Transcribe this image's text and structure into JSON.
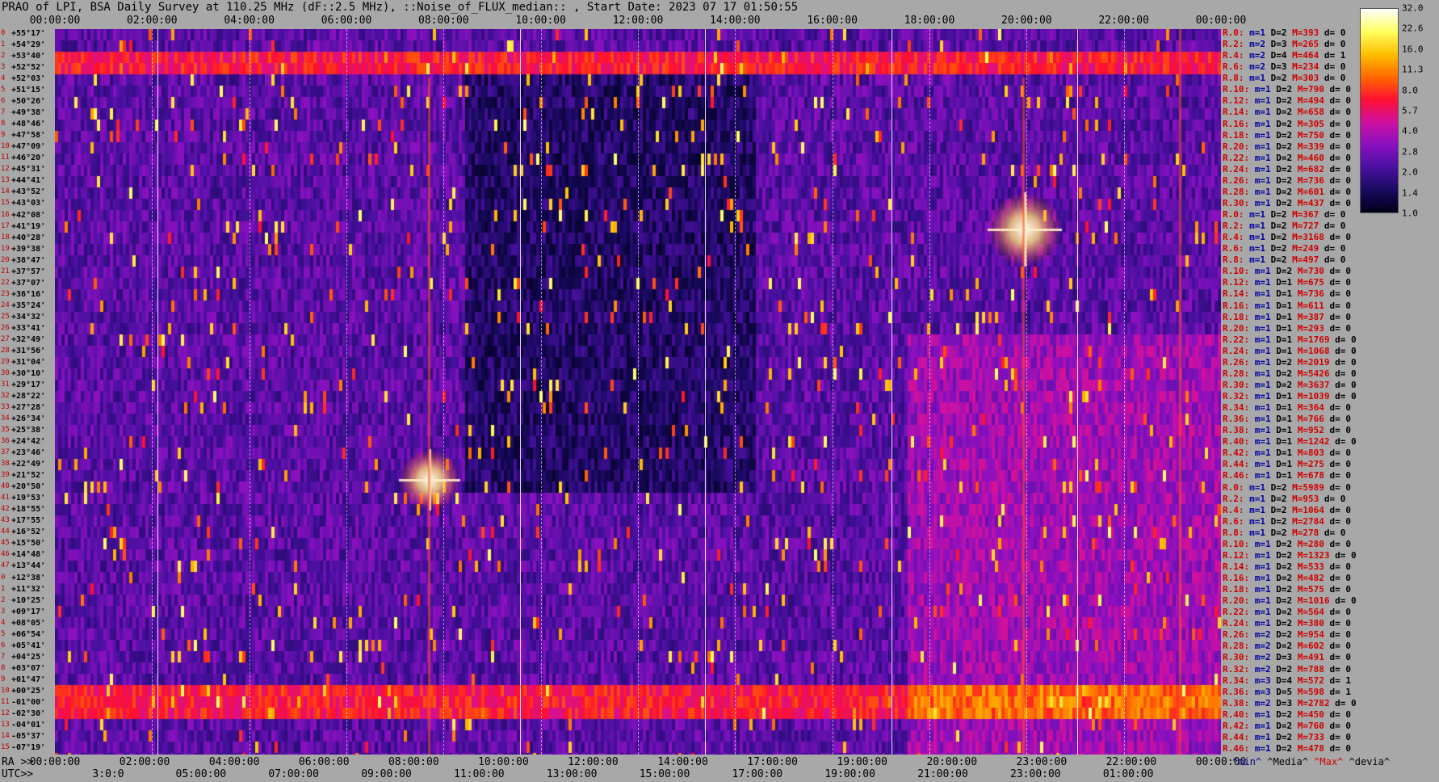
{
  "title": "PRAO of LPI, BSA Daily Survey at 110.25 MHz (dF::2.5 MHz), ::Noise_of_FLUX_median:: , Start Date: 2023 07 17 01:50:55",
  "chart_data": {
    "type": "heatmap",
    "title": "PRAO of LPI, BSA Daily Survey at 110.25 MHz (dF::2.5 MHz), ::Noise_of_FLUX_median:: , Start Date: 2023 07 17 01:50:55",
    "top_axis_ticks": [
      "00:00:00",
      "02:00:00",
      "04:00:00",
      "06:00:00",
      "08:00:00",
      "10:00:00",
      "12:00:00",
      "14:00:00",
      "16:00:00",
      "18:00:00",
      "20:00:00",
      "22:00:00",
      "00:00:00"
    ],
    "ra_label": "RA >>",
    "ra_ticks": [
      "00:00:00",
      "02:00:00",
      "04:00:00",
      "06:00:00",
      "08:00:00",
      "10:00:00",
      "12:00:00",
      "14:00:00",
      "17:00:00",
      "19:00:00",
      "20:00:00",
      "23:00:00",
      "22:00:00",
      "00:00:00"
    ],
    "utc_label": "UTC>>",
    "utc_ticks": [
      "3:0:0",
      "05:00:00",
      "07:00:00",
      "09:00:00",
      "11:00:00",
      "13:00:00",
      "15:00:00",
      "17:00:00",
      "19:00:00",
      "21:00:00",
      "23:00:00",
      "01:00:00"
    ],
    "declinations": [
      "+55°17'",
      "+54°29'",
      "+53°40'",
      "+52°52'",
      "+52°03'",
      "+51°15'",
      "+50°26'",
      "+49°38'",
      "+48°46'",
      "+47°58'",
      "+47°09'",
      "+46°20'",
      "+45°31'",
      "+44°41'",
      "+43°52'",
      "+43°03'",
      "+42°08'",
      "+41°19'",
      "+40°28'",
      "+39°38'",
      "+38°47'",
      "+37°57'",
      "+37°07'",
      "+36°16'",
      "+35°24'",
      "+34°32'",
      "+33°41'",
      "+32°49'",
      "+31°56'",
      "+31°04'",
      "+30°10'",
      "+29°17'",
      "+28°22'",
      "+27°28'",
      "+26°34'",
      "+25°38'",
      "+24°42'",
      "+23°46'",
      "+22°49'",
      "+21°52'",
      "+20°50'",
      "+19°53'",
      "+18°55'",
      "+17°55'",
      "+16°52'",
      "+15°50'",
      "+14°48'",
      "+13°44'",
      "+12°38'",
      "+11°32'",
      "+10°25'",
      "+09°17'",
      "+08°05'",
      "+06°54'",
      "+05°41'",
      "+04°25'",
      "+03°07'",
      "+01°47'",
      "+00°25'",
      "-01°00'",
      "-02°30'",
      "-04°01'",
      "-05°37'",
      "-07°19'"
    ],
    "stats": [
      [
        "R.0:",
        "m=1",
        "D=2",
        "M=393",
        "d= 0"
      ],
      [
        "R.2:",
        "m=2",
        "D=3",
        "M=265",
        "d= 0"
      ],
      [
        "R.4:",
        "m=2",
        "D=4",
        "M=464",
        "d= 1"
      ],
      [
        "R.6:",
        "m=2",
        "D=3",
        "M=234",
        "d= 0"
      ],
      [
        "R.8:",
        "m=1",
        "D=2",
        "M=303",
        "d= 0"
      ],
      [
        "R.10:",
        "m=1",
        "D=2",
        "M=790",
        "d= 0"
      ],
      [
        "R.12:",
        "m=1",
        "D=2",
        "M=494",
        "d= 0"
      ],
      [
        "R.14:",
        "m=1",
        "D=2",
        "M=658",
        "d= 0"
      ],
      [
        "R.16:",
        "m=1",
        "D=2",
        "M=305",
        "d= 0"
      ],
      [
        "R.18:",
        "m=1",
        "D=2",
        "M=750",
        "d= 0"
      ],
      [
        "R.20:",
        "m=1",
        "D=2",
        "M=339",
        "d= 0"
      ],
      [
        "R.22:",
        "m=1",
        "D=2",
        "M=460",
        "d= 0"
      ],
      [
        "R.24:",
        "m=1",
        "D=2",
        "M=682",
        "d= 0"
      ],
      [
        "R.26:",
        "m=1",
        "D=2",
        "M=736",
        "d= 0"
      ],
      [
        "R.28:",
        "m=1",
        "D=2",
        "M=601",
        "d= 0"
      ],
      [
        "R.30:",
        "m=1",
        "D=2",
        "M=437",
        "d= 0"
      ],
      [
        "R.0:",
        "m=1",
        "D=2",
        "M=367",
        "d= 0"
      ],
      [
        "R.2:",
        "m=1",
        "D=2",
        "M=727",
        "d= 0"
      ],
      [
        "R.4:",
        "m=1",
        "D=2",
        "M=3168",
        "d= 0"
      ],
      [
        "R.6:",
        "m=1",
        "D=2",
        "M=249",
        "d= 0"
      ],
      [
        "R.8:",
        "m=1",
        "D=2",
        "M=497",
        "d= 0"
      ],
      [
        "R.10:",
        "m=1",
        "D=2",
        "M=730",
        "d= 0"
      ],
      [
        "R.12:",
        "m=1",
        "D=1",
        "M=675",
        "d= 0"
      ],
      [
        "R.14:",
        "m=1",
        "D=1",
        "M=736",
        "d= 0"
      ],
      [
        "R.16:",
        "m=1",
        "D=1",
        "M=611",
        "d= 0"
      ],
      [
        "R.18:",
        "m=1",
        "D=1",
        "M=387",
        "d= 0"
      ],
      [
        "R.20:",
        "m=1",
        "D=1",
        "M=293",
        "d= 0"
      ],
      [
        "R.22:",
        "m=1",
        "D=1",
        "M=1769",
        "d= 0"
      ],
      [
        "R.24:",
        "m=1",
        "D=1",
        "M=1068",
        "d= 0"
      ],
      [
        "R.26:",
        "m=1",
        "D=2",
        "M=2019",
        "d= 0"
      ],
      [
        "R.28:",
        "m=1",
        "D=2",
        "M=5426",
        "d= 0"
      ],
      [
        "R.30:",
        "m=1",
        "D=2",
        "M=3637",
        "d= 0"
      ],
      [
        "R.32:",
        "m=1",
        "D=1",
        "M=1039",
        "d= 0"
      ],
      [
        "R.34:",
        "m=1",
        "D=1",
        "M=364",
        "d= 0"
      ],
      [
        "R.36:",
        "m=1",
        "D=1",
        "M=766",
        "d= 0"
      ],
      [
        "R.38:",
        "m=1",
        "D=1",
        "M=952",
        "d= 0"
      ],
      [
        "R.40:",
        "m=1",
        "D=1",
        "M=1242",
        "d= 0"
      ],
      [
        "R.42:",
        "m=1",
        "D=1",
        "M=803",
        "d= 0"
      ],
      [
        "R.44:",
        "m=1",
        "D=1",
        "M=275",
        "d= 0"
      ],
      [
        "R.46:",
        "m=1",
        "D=1",
        "M=678",
        "d= 0"
      ],
      [
        "R.0:",
        "m=1",
        "D=2",
        "M=5989",
        "d= 0"
      ],
      [
        "R.2:",
        "m=1",
        "D=2",
        "M=953",
        "d= 0"
      ],
      [
        "R.4:",
        "m=1",
        "D=2",
        "M=1064",
        "d= 0"
      ],
      [
        "R.6:",
        "m=1",
        "D=2",
        "M=2784",
        "d= 0"
      ],
      [
        "R.8:",
        "m=1",
        "D=2",
        "M=278",
        "d= 0"
      ],
      [
        "R.10:",
        "m=1",
        "D=2",
        "M=280",
        "d= 0"
      ],
      [
        "R.12:",
        "m=1",
        "D=2",
        "M=1323",
        "d= 0"
      ],
      [
        "R.14:",
        "m=1",
        "D=2",
        "M=533",
        "d= 0"
      ],
      [
        "R.16:",
        "m=1",
        "D=2",
        "M=482",
        "d= 0"
      ],
      [
        "R.18:",
        "m=1",
        "D=2",
        "M=575",
        "d= 0"
      ],
      [
        "R.20:",
        "m=1",
        "D=2",
        "M=1016",
        "d= 0"
      ],
      [
        "R.22:",
        "m=1",
        "D=2",
        "M=564",
        "d= 0"
      ],
      [
        "R.24:",
        "m=1",
        "D=2",
        "M=380",
        "d= 0"
      ],
      [
        "R.26:",
        "m=2",
        "D=2",
        "M=954",
        "d= 0"
      ],
      [
        "R.28:",
        "m=2",
        "D=2",
        "M=602",
        "d= 0"
      ],
      [
        "R.30:",
        "m=2",
        "D=3",
        "M=491",
        "d= 0"
      ],
      [
        "R.32:",
        "m=2",
        "D=2",
        "M=788",
        "d= 0"
      ],
      [
        "R.34:",
        "m=3",
        "D=4",
        "M=572",
        "d= 1"
      ],
      [
        "R.36:",
        "m=3",
        "D=5",
        "M=598",
        "d= 1"
      ],
      [
        "R.38:",
        "m=2",
        "D=3",
        "M=2782",
        "d= 0"
      ],
      [
        "R.40:",
        "m=1",
        "D=2",
        "M=450",
        "d= 0"
      ],
      [
        "R.42:",
        "m=1",
        "D=2",
        "M=760",
        "d= 0"
      ],
      [
        "R.44:",
        "m=1",
        "D=2",
        "M=733",
        "d= 0"
      ],
      [
        "R.46:",
        "m=1",
        "D=2",
        "M=478",
        "d= 0"
      ]
    ],
    "colorbar_ticks": [
      "32.0",
      "22.6",
      "16.0",
      "11.3",
      "8.0",
      "5.7",
      "4.0",
      "2.8",
      "2.0",
      "1.4",
      "1.0"
    ],
    "colorbar_range": [
      1.0,
      32.0
    ],
    "colors": [
      "#000018",
      "#1a0a60",
      "#4a10a0",
      "#8a10c0",
      "#d010a0",
      "#ff1030",
      "#ff6a00",
      "#ffc000",
      "#ffff60",
      "#ffffff"
    ]
  },
  "footer": {
    "min": "^min^",
    "med": "^Media^",
    "max": "^Max^",
    "dev": "^devia^"
  }
}
